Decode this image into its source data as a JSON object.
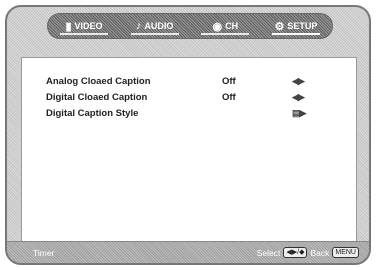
{
  "tabs": [
    {
      "icon": "tv-icon",
      "glyph": "▮",
      "label": "VIDEO"
    },
    {
      "icon": "audio-icon",
      "glyph": "♪",
      "label": "AUDIO"
    },
    {
      "icon": "channel-icon",
      "glyph": "◉",
      "label": "CH"
    },
    {
      "icon": "settings-icon",
      "glyph": "⚙",
      "label": "SETUP"
    }
  ],
  "menu": {
    "items": [
      {
        "label": "Analog Cloaed Caption",
        "value": "Off",
        "arrow": "◀▶"
      },
      {
        "label": "Digital Cloaed Caption",
        "value": "Off",
        "arrow": "◀▶"
      },
      {
        "label": "Digital Caption Style",
        "value": "",
        "arrow": "▤▶"
      }
    ]
  },
  "footer": {
    "left": "Timer",
    "select_label": "Select",
    "select_keys": "◀▶/◆",
    "back_label": "Back",
    "back_key": "MENU"
  }
}
